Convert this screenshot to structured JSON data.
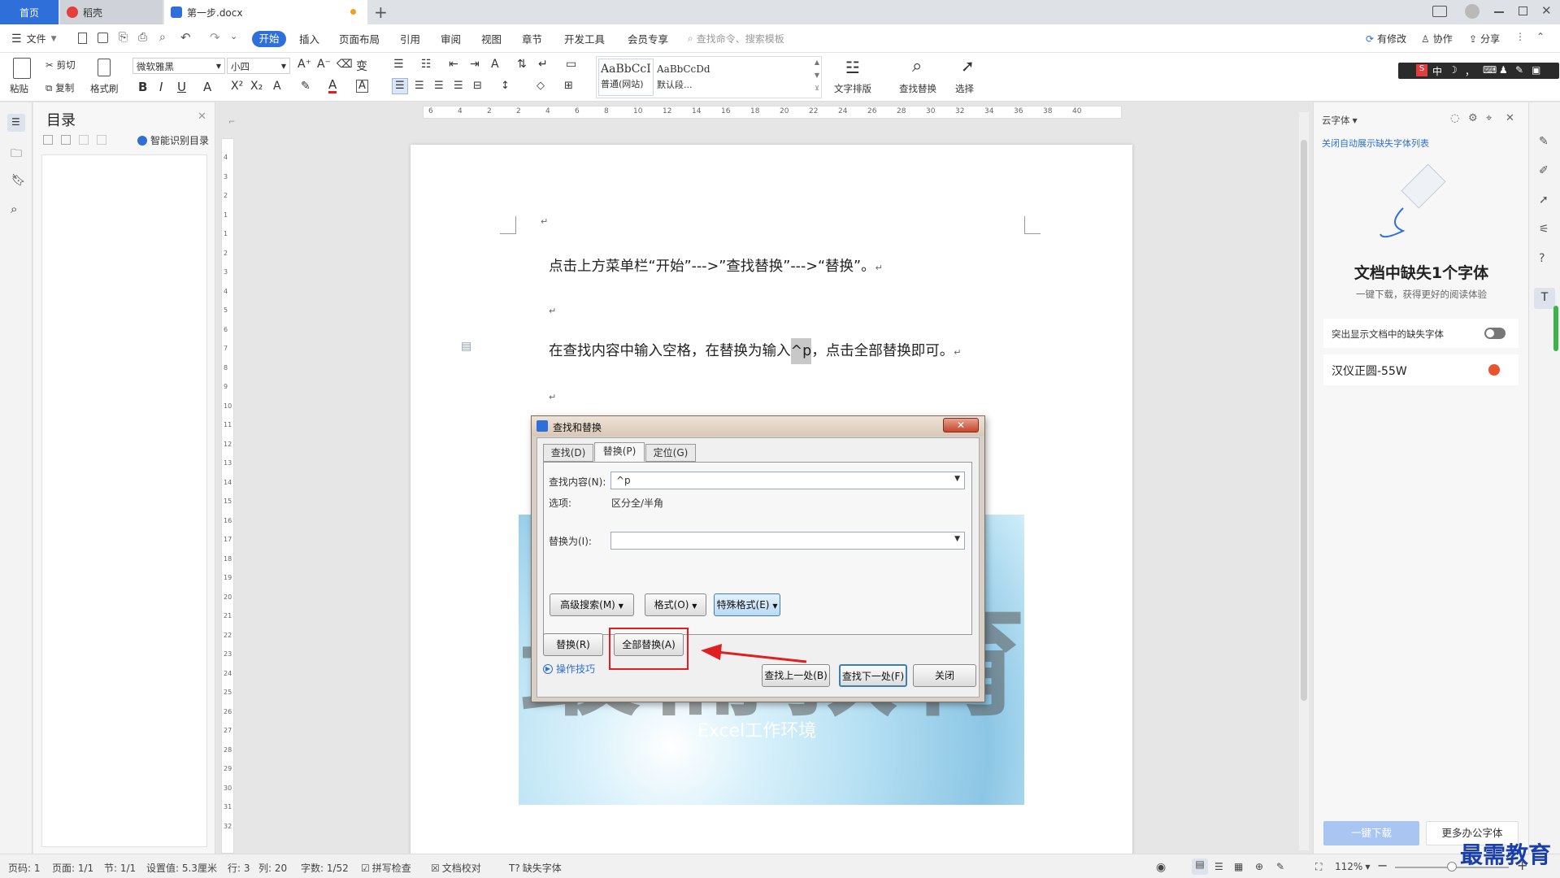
{
  "tabs": {
    "home": "首页",
    "docer": "稻壳",
    "document": "第一步.docx",
    "new_tab": "+"
  },
  "menubar": {
    "file": "文件",
    "items": [
      "开始",
      "插入",
      "页面布局",
      "引用",
      "审阅",
      "视图",
      "章节",
      "开发工具",
      "会员专享"
    ],
    "search_placeholder": "查找命令、搜索模板",
    "right": {
      "changes": "有修改",
      "collab": "协作",
      "share": "分享"
    }
  },
  "ribbon": {
    "paste": "粘贴",
    "cut": "剪切",
    "copy": "复制",
    "format_painter": "格式刷",
    "font_name": "微软雅黑",
    "font_size": "小四",
    "style_preview1": "AaBbCcI",
    "style_preview2": "AaBbCcDd",
    "style_name1": "普通(网站)",
    "style_name2": "默认段...",
    "text_layout": "文字排版",
    "find_replace": "查找替换",
    "select": "选择"
  },
  "toc": {
    "title": "目录",
    "smart_toc": "智能识别目录"
  },
  "ruler": {
    "h_ticks": [
      "6",
      "4",
      "2",
      "2",
      "4",
      "6",
      "8",
      "10",
      "12",
      "14",
      "16",
      "18",
      "20",
      "22",
      "24",
      "26",
      "28",
      "30",
      "32",
      "34",
      "36",
      "38",
      "40"
    ],
    "v_ticks": [
      "4",
      "3",
      "2",
      "1",
      "1",
      "2",
      "3",
      "4",
      "5",
      "6",
      "7",
      "8",
      "9",
      "10",
      "11",
      "12",
      "13",
      "14",
      "15",
      "16",
      "17",
      "18",
      "19",
      "20",
      "21",
      "22",
      "23",
      "24",
      "25",
      "26",
      "27",
      "28",
      "29",
      "30",
      "31",
      "32"
    ]
  },
  "document": {
    "para1": "点击上方菜单栏“开始”--->”查找替换”--->“替换”。",
    "para2_before": "在查找内容中输入空格，在替换为输入",
    "para2_highlight": "^p",
    "para2_after": "，点击全部替换即可。",
    "paragraph_mark": "↵",
    "watermark_text": "最需教育",
    "watermark_sub": "Excel工作环境"
  },
  "dialog": {
    "title": "查找和替换",
    "tabs": [
      "查找(D)",
      "替换(P)",
      "定位(G)"
    ],
    "find_label": "查找内容(N):",
    "find_value": "^p",
    "options_label": "选项:",
    "options_value": "区分全/半角",
    "replace_label": "替换为(I):",
    "replace_value": "",
    "advanced": "高级搜索(M)",
    "format": "格式(O)",
    "special": "特殊格式(E)",
    "replace_btn": "替换(R)",
    "replace_all_btn": "全部替换(A)",
    "tips": "操作技巧",
    "find_prev": "查找上一处(B)",
    "find_next": "查找下一处(F)",
    "close": "关闭"
  },
  "cloud_font": {
    "header": "云字体",
    "hide_link": "关闭自动展示缺失字体列表",
    "headline": "文档中缺失1个字体",
    "sub": "一键下载，获得更好的阅读体验",
    "highlight_toggle_label": "突出显示文档中的缺失字体",
    "missing_font": "汉仪正圆-55W",
    "download_btn": "一键下载",
    "more_btn": "更多办公字体"
  },
  "statusbar": {
    "page": "页码: 1",
    "pages": "页面: 1/1",
    "section": "节: 1/1",
    "setting": "设置值: 5.3厘米",
    "row": "行: 3",
    "col": "列: 20",
    "words": "字数: 1/52",
    "spell": "拼写检查",
    "proof": "文档校对",
    "missing_font": "缺失字体",
    "zoom": "112%"
  },
  "watermark_corner": "最需教育",
  "colors": {
    "accent": "#2e6fd9",
    "highlight_red": "#e02020",
    "download_btn": "#a9c6f2"
  }
}
